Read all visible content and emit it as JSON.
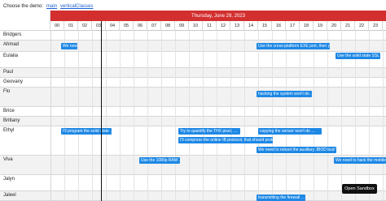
{
  "demo_selector": {
    "label": "Choose the demo:",
    "options": [
      "main",
      "verticalClasses"
    ]
  },
  "header": {
    "date": "Thursday, June 29, 2023",
    "hours": [
      "00",
      "01",
      "02",
      "03",
      "04",
      "05",
      "06",
      "07",
      "08",
      "09",
      "10",
      "11",
      "12",
      "13",
      "14",
      "15",
      "16",
      "17",
      "18",
      "19",
      "20",
      "21",
      "22",
      "23"
    ]
  },
  "resources": [
    "Bridgers",
    "Ahmad",
    "Eulalia",
    "Paul",
    "Geovany",
    "Flo",
    "Brice",
    "Brittany",
    "Ethyl",
    "Viva",
    "Jalyn",
    "Jaleel"
  ],
  "events": [
    "We need to …",
    "Use the cross-platform EXE port, then you …",
    "Use the solid state SSL …",
    "hacking the system won't do …",
    "I'll program the solid state …",
    "Try to quantify the THX pixel, …",
    "copying the sensor won't do …",
    "I'll compress the online IB protocol, that should protocol …",
    "We need to reboot the auxiliary JBOD bus! …",
    "Use the 1080p RAM …",
    "We need to hack the mobile IB …",
    "transmitting the firewall …"
  ],
  "open_sandbox_label": "Open Sandbox",
  "colors": {
    "header": "#d32f2f",
    "event": "#1e88e5",
    "now_line": "#111111"
  }
}
